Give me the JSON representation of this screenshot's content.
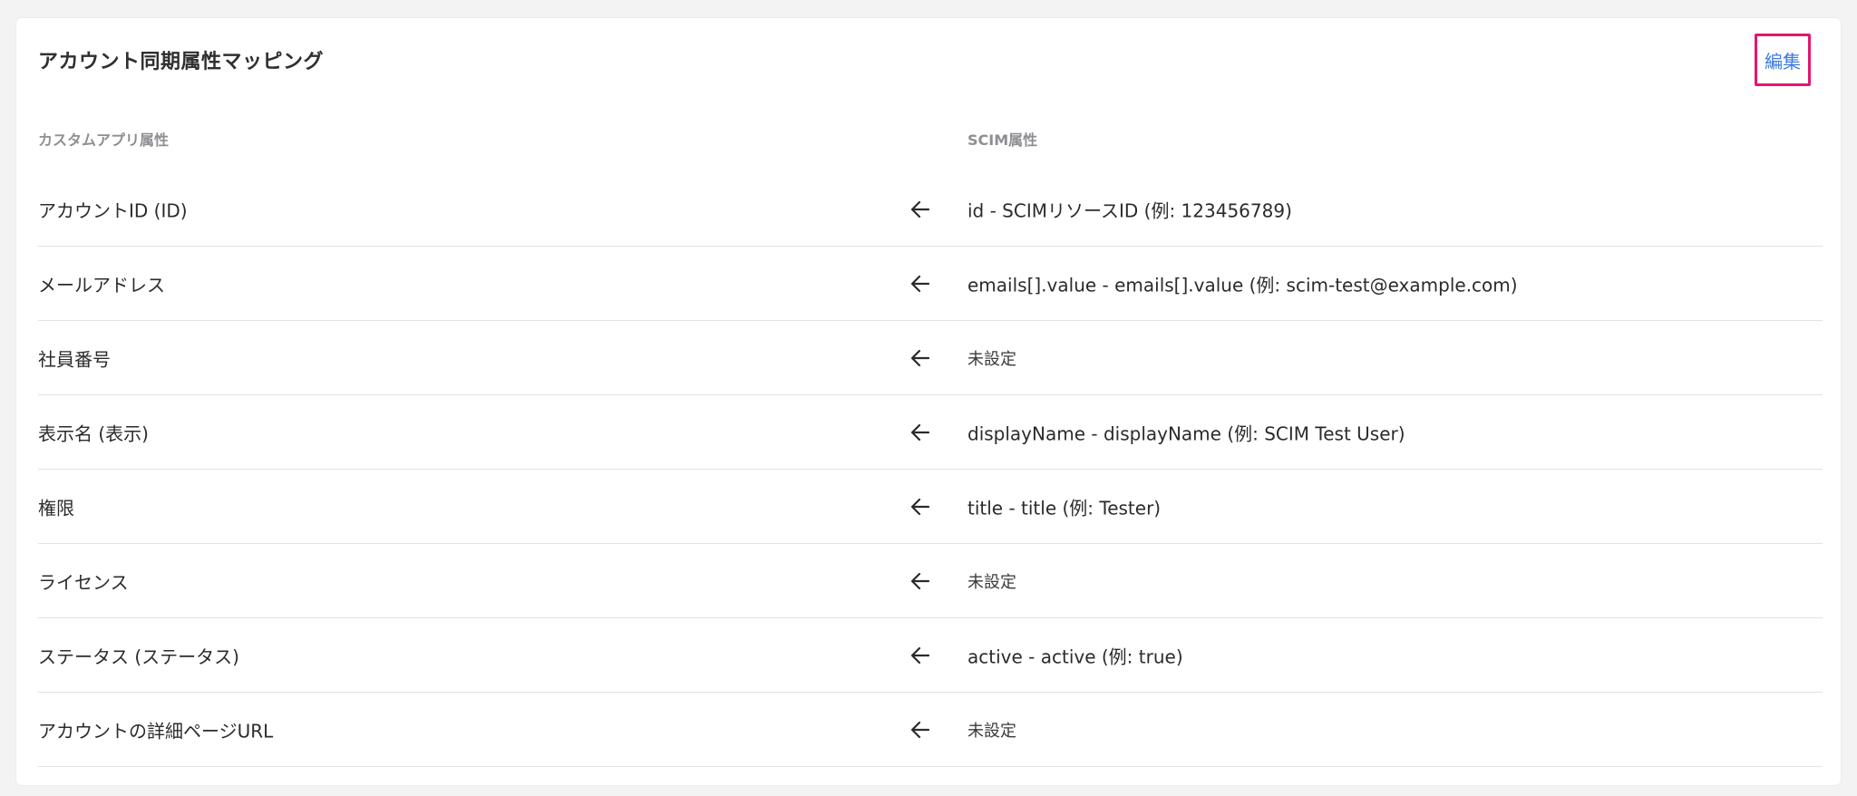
{
  "card": {
    "title": "アカウント同期属性マッピング",
    "edit_label": "編集"
  },
  "columns": {
    "left_header": "カスタムアプリ属性",
    "right_header": "SCIM属性"
  },
  "icons": {
    "arrow": "arrow-left-icon"
  },
  "colors": {
    "edit_link": "#3d7be0",
    "highlight_border": "#e5166f"
  },
  "rows": [
    {
      "app_attr": "アカウントID (ID)",
      "scim_attr": "id - SCIMリソースID (例: 123456789)"
    },
    {
      "app_attr": "メールアドレス",
      "scim_attr": "emails[].value - emails[].value (例: scim-test@example.com)"
    },
    {
      "app_attr": "社員番号",
      "scim_attr": "未設定"
    },
    {
      "app_attr": "表示名 (表示)",
      "scim_attr": "displayName - displayName (例: SCIM Test User)"
    },
    {
      "app_attr": "権限",
      "scim_attr": "title - title (例: Tester)"
    },
    {
      "app_attr": "ライセンス",
      "scim_attr": "未設定"
    },
    {
      "app_attr": "ステータス (ステータス)",
      "scim_attr": "active - active (例: true)"
    },
    {
      "app_attr": "アカウントの詳細ページURL",
      "scim_attr": "未設定"
    }
  ]
}
